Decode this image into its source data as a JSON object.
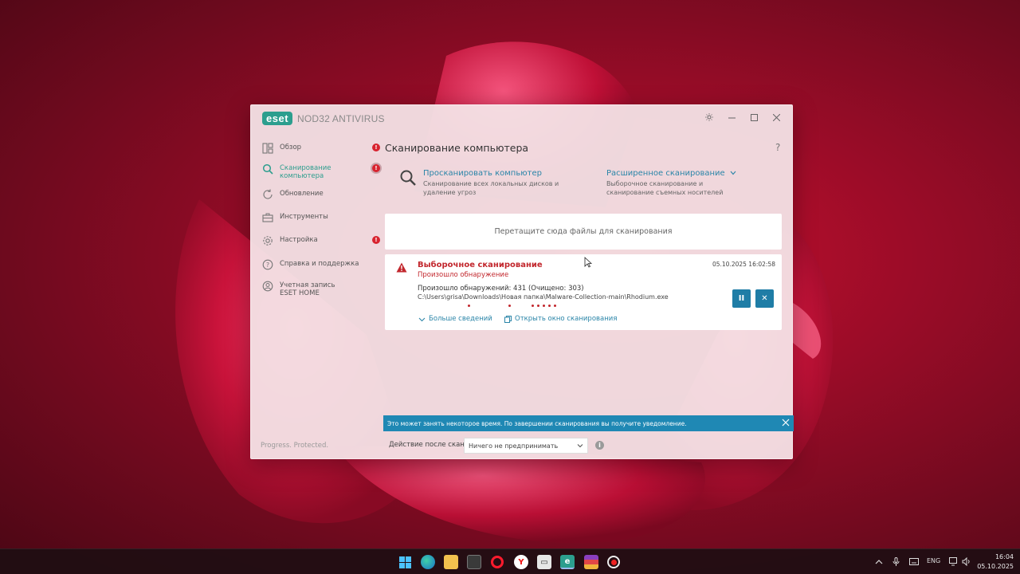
{
  "window": {
    "logo_badge": "eset",
    "logo_product": "NOD32 ANTIVIRUS",
    "tagline": "Progress. Protected."
  },
  "sidebar": {
    "items": [
      {
        "label": "Обзор",
        "icon": "overview-icon",
        "badge": "!"
      },
      {
        "label": "Сканирование компьютера",
        "icon": "search-icon",
        "badge": "!",
        "active": true
      },
      {
        "label": "Обновление",
        "icon": "refresh-icon"
      },
      {
        "label": "Инструменты",
        "icon": "toolbox-icon"
      },
      {
        "label": "Настройка",
        "icon": "gear-icon",
        "badge": "!"
      },
      {
        "label": "Справка и поддержка",
        "icon": "help-icon"
      },
      {
        "label": "Учетная запись ESET HOME",
        "icon": "user-icon"
      }
    ]
  },
  "main": {
    "title": "Сканирование компьютера",
    "help": "?",
    "scan_computer": {
      "title": "Просканировать компьютер",
      "desc": "Сканирование всех локальных дисков и удаление угроз"
    },
    "advanced_scan": {
      "title": "Расширенное сканирование",
      "desc": "Выборочное сканирование и сканирование съемных носителей"
    },
    "dropzone": "Перетащите сюда файлы для сканирования",
    "scan_card": {
      "title": "Выборочное сканирование",
      "subtitle": "Произошло обнаружение",
      "date": "05.10.2025 16:02:58",
      "detections": "Произошло обнаружений: 431 (Очищено: 303)",
      "path": "C:\\Users\\grisa\\Downloads\\Новая папка\\Malware-Collection-main\\Rhodium.exe",
      "more_details": "Больше сведений",
      "open_window": "Открыть окно сканирования",
      "pause": "II",
      "stop": "✕"
    },
    "notice": "Это может занять некоторое время. По завершении сканирования вы получите уведомление.",
    "after_scan_label": "Действие после скан.",
    "after_scan_value": "Ничего не предпринимать"
  },
  "taskbar": {
    "lang": "ENG",
    "time": "16:04",
    "date": "05.10.2025"
  },
  "colors": {
    "accent": "#2c9e8e",
    "link": "#2a85a8",
    "alert": "#c2272d",
    "notice": "#1f88b4"
  }
}
